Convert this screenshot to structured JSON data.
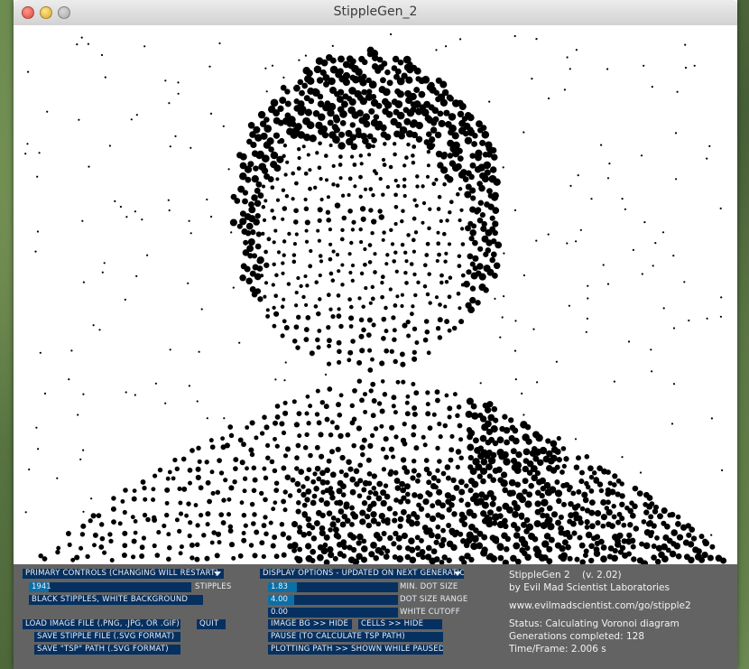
{
  "window": {
    "title": "StippleGen_2"
  },
  "primary": {
    "header": "PRIMARY CONTROLS (CHANGING WILL RESTART)",
    "stipples_value": "1941",
    "stipples_label": "STIPPLES",
    "stipples_fraction": 0.12,
    "color_mode": "BLACK STIPPLES, WHITE BACKGROUND",
    "load_image": "LOAD IMAGE FILE (.PNG, .JPG, OR .GIF)",
    "quit": "QUIT",
    "save_stipple": "SAVE STIPPLE FILE (.SVG FORMAT)",
    "save_tsp": "SAVE \"TSP\" PATH (.SVG FORMAT)"
  },
  "display": {
    "header": "DISPLAY OPTIONS - UPDATED ON NEXT GENERATION",
    "min_dot_value": "1.83",
    "min_dot_label": "MIN. DOT SIZE",
    "min_dot_fraction": 0.22,
    "dot_range_value": "4.00",
    "dot_range_label": "DOT SIZE RANGE",
    "dot_range_fraction": 0.2,
    "white_cutoff_value": "0.00",
    "white_cutoff_label": "WHITE CUTOFF",
    "white_cutoff_fraction": 0.0,
    "image_bg": "IMAGE BG >> HIDE",
    "cells": "CELLS >> HIDE",
    "pause": "PAUSE (TO CALCULATE TSP PATH)",
    "plotting_path": "PLOTTING PATH >> SHOWN WHILE PAUSED"
  },
  "info": {
    "app_name": "StippleGen 2",
    "version": "(v. 2.02)",
    "author": "by Evil Mad Scientist Laboratories",
    "url": "www.evilmadscientist.com/go/stipple2",
    "status": "Status: Calculating Voronoi diagram",
    "generations": "Generations completed: 128",
    "time_frame": "Time/Frame: 2.006 s"
  },
  "colors": {
    "panel": "#636363",
    "control": "#063060",
    "slider_fill": "#0b6fa8",
    "dots": "#000000"
  }
}
